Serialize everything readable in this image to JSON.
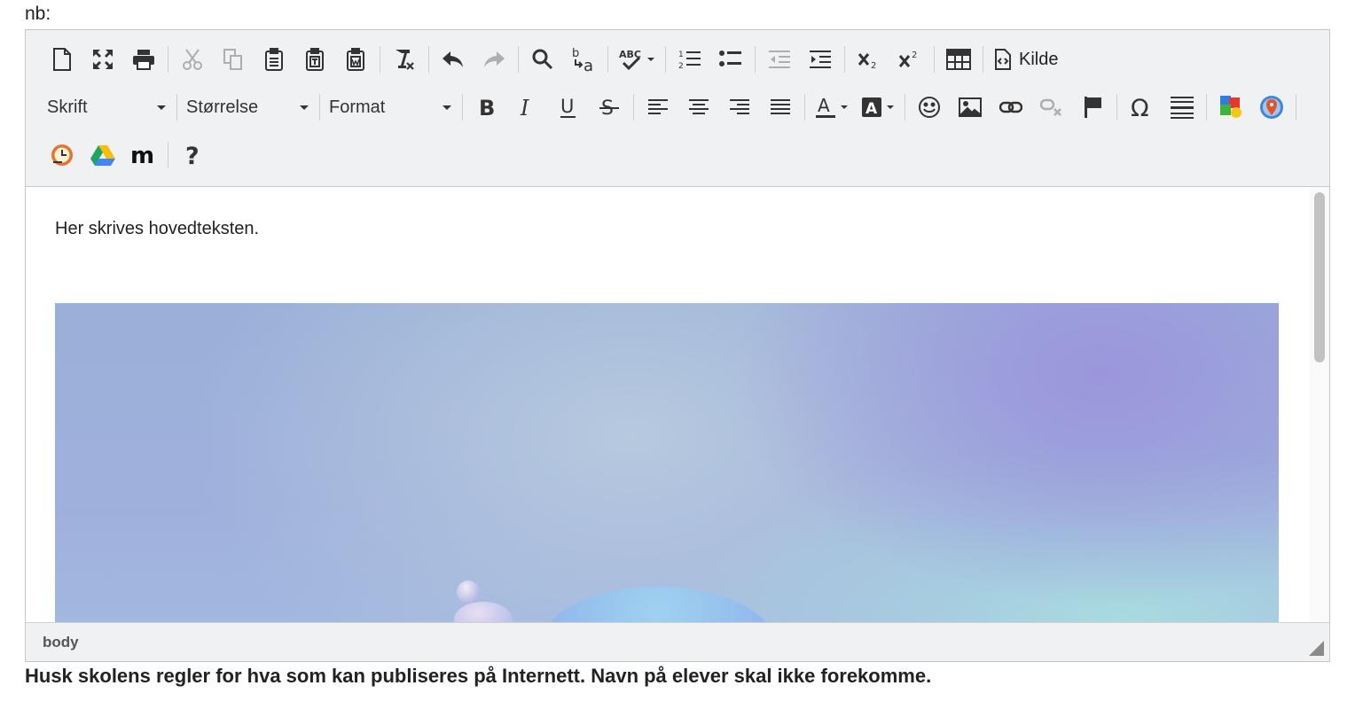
{
  "field_label": "nb:",
  "toolbar": {
    "source_label": "Kilde",
    "font_label": "Skrift",
    "size_label": "Størrelse",
    "format_label": "Format"
  },
  "content": {
    "paragraph": "Her skrives hovedteksten."
  },
  "statusbar": {
    "path": "body"
  },
  "notice": "Husk skolens regler for hva som kan publiseres på Internett. Navn på elever skal ikke forekomme."
}
